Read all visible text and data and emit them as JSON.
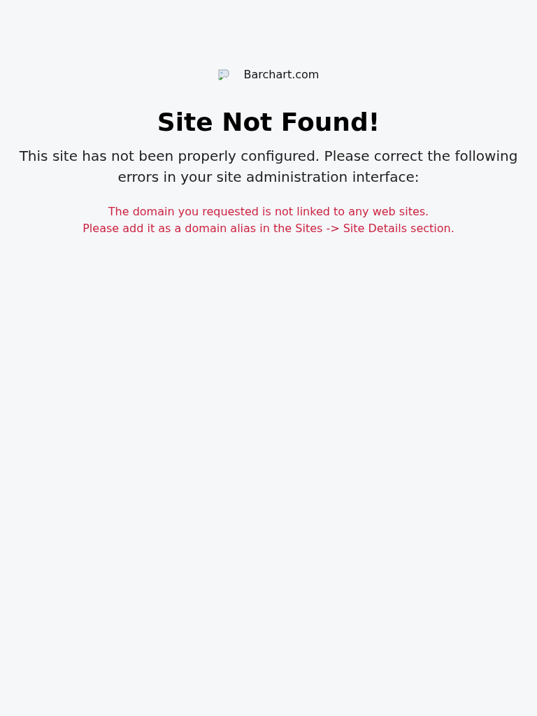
{
  "logo": {
    "alt_text": "Barchart.com"
  },
  "title": "Site Not Found!",
  "message": "This site has not been properly configured. Please correct the following errors in your site administration interface:",
  "errors": [
    "The domain you requested is not linked to any web sites.",
    "Please add it as a domain alias in the Sites -> Site Details section."
  ]
}
